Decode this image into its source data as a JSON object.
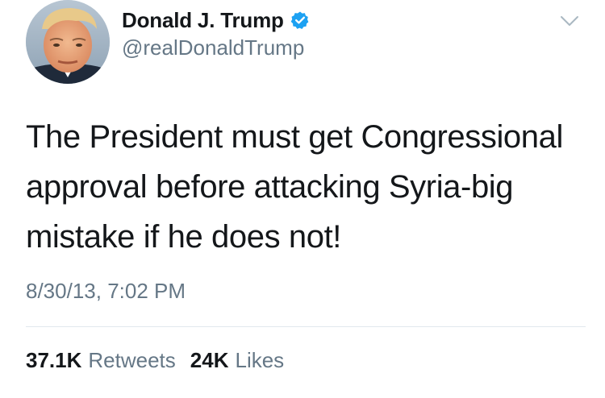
{
  "author": {
    "name": "Donald J. Trump",
    "handle": "@realDonaldTrump",
    "verified": true
  },
  "icons": {
    "verified": "verified-badge-icon",
    "menu": "chevron-down-icon"
  },
  "tweet": {
    "text": "The President must get Congressional approval before attacking Syria-big mistake if he does not!",
    "timestamp": "8/30/13, 7:02 PM"
  },
  "stats": {
    "retweets_count": "37.1K",
    "retweets_label": "Retweets",
    "likes_count": "24K",
    "likes_label": "Likes"
  },
  "colors": {
    "text_primary": "#14171a",
    "text_secondary": "#657786",
    "verified_blue": "#1da1f2",
    "divider": "#e1e8ed"
  }
}
